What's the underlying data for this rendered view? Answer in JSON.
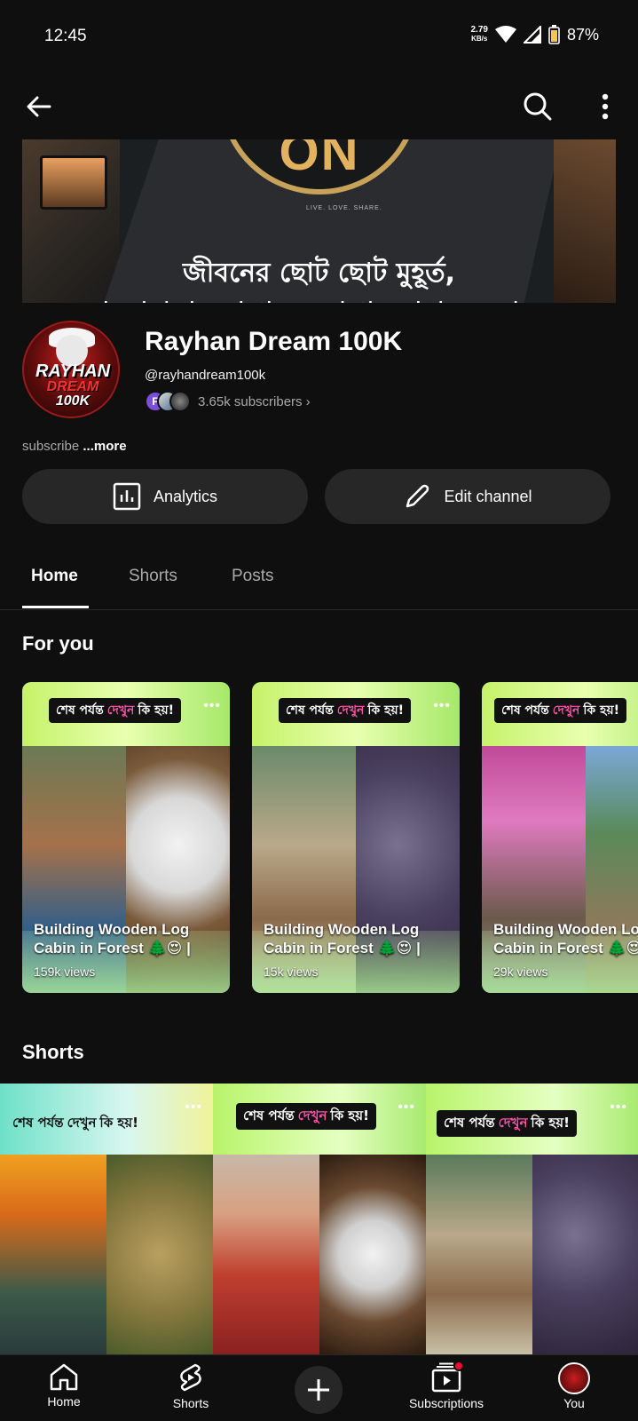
{
  "status_bar": {
    "time": "12:45",
    "net_speed_value": "2.79",
    "net_speed_unit": "KB/s",
    "battery": "87%"
  },
  "banner": {
    "logo_text": "ON",
    "tagline": "LIVE. LOVE. SHARE.",
    "caption_line1": "জীবনের ছোট ছোট মুহূর্ত,",
    "caption_line2": "ভালোবাসার সাথে একসাথে তোমাদের কাছে।"
  },
  "avatar": {
    "line1": "RAYHAN",
    "line2": "DREAM",
    "line3": "100K"
  },
  "channel": {
    "name": "Rayhan Dream 100K",
    "handle": "@rayhandream100k",
    "subscriber_initial": "F",
    "subscribers": "3.65k subscribers",
    "description": "subscribe",
    "more_label": "...more"
  },
  "actions": {
    "analytics_label": "Analytics",
    "edit_label": "Edit channel"
  },
  "tabs": [
    {
      "label": "Home"
    },
    {
      "label": "Shorts"
    },
    {
      "label": "Posts"
    }
  ],
  "sections": {
    "for_you": "For you",
    "shorts": "Shorts"
  },
  "for_you_videos": [
    {
      "banner_a": "শেষ পর্যন্ত",
      "banner_hl": "দেখুন",
      "banner_b": "কি হয়!",
      "title": "Building Wooden Log Cabin in Forest 🌲😍 |",
      "views": "159k views"
    },
    {
      "banner_a": "শেষ পর্যন্ত",
      "banner_hl": "দেখুন",
      "banner_b": "কি হয়!",
      "title": "Building Wooden Log Cabin in Forest 🌲😍 |",
      "views": "15k views"
    },
    {
      "banner_a": "শেষ পর্যন্ত",
      "banner_hl": "দেখুন",
      "banner_b": "কি হয়!",
      "title": "Building Wooden Log Cabin in Forest 🌲😍 |",
      "views": "29k views"
    }
  ],
  "shorts": [
    {
      "banner_a": "শেষ পর্যন্ত",
      "banner_hl": "দেখুন",
      "banner_b": "কি হয়!"
    },
    {
      "banner_a": "শেষ পর্যন্ত",
      "banner_hl": "দেখুন",
      "banner_b": "কি হয়!"
    },
    {
      "banner_a": "শেষ পর্যন্ত",
      "banner_hl": "দেখুন",
      "banner_b": "কি হয়!"
    }
  ],
  "bottom_nav": {
    "home": "Home",
    "shorts": "Shorts",
    "subscriptions": "Subscriptions",
    "you": "You"
  },
  "colors": {
    "background": "#0f0f0f",
    "chip": "#272727",
    "notification_dot": "#ff0033",
    "banner_green": "#c6f26a"
  }
}
